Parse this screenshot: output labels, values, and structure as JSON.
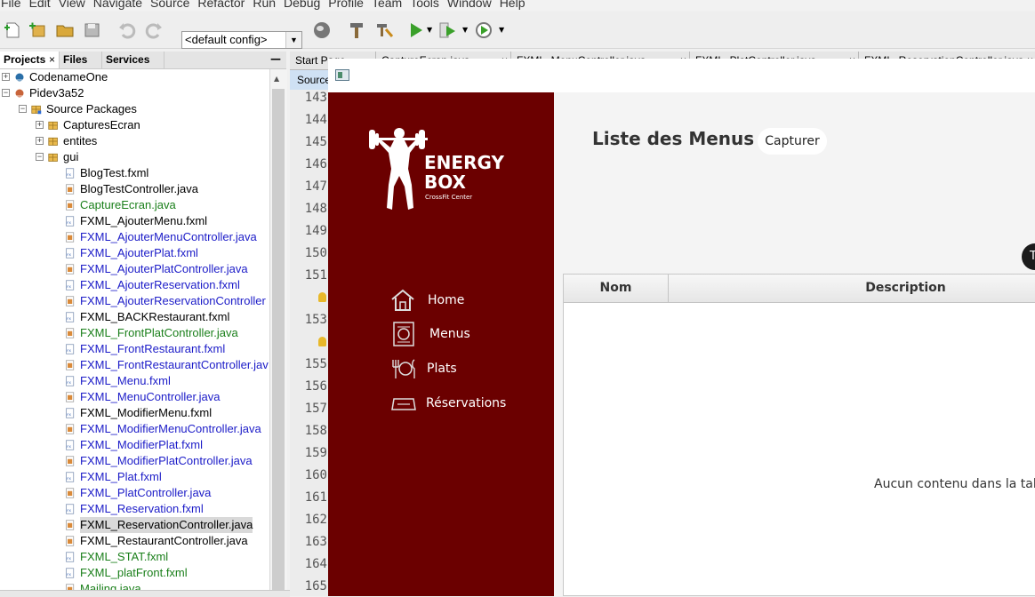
{
  "menubar": [
    "File",
    "Edit",
    "View",
    "Navigate",
    "Source",
    "Refactor",
    "Run",
    "Debug",
    "Profile",
    "Team",
    "Tools",
    "Window",
    "Help"
  ],
  "toolbar": {
    "config": "<default config>"
  },
  "project_panel": {
    "tabs": [
      "Projects",
      "Files",
      "Services"
    ],
    "close_glyph": "×",
    "minimize_glyph": "—"
  },
  "tree": [
    {
      "label": "CodenameOne",
      "level": 0,
      "kind": "project",
      "exp": "+",
      "color": "#000000"
    },
    {
      "label": "Pidev3a52",
      "level": 0,
      "kind": "project",
      "exp": "−",
      "color": "#000000"
    },
    {
      "label": "Source Packages",
      "level": 1,
      "kind": "srcpkg",
      "exp": "−",
      "color": "#000000"
    },
    {
      "label": "CapturesEcran",
      "level": 2,
      "kind": "package",
      "exp": "+",
      "color": "#000000"
    },
    {
      "label": "entites",
      "level": 2,
      "kind": "package",
      "exp": "+",
      "color": "#000000"
    },
    {
      "label": "gui",
      "level": 2,
      "kind": "package",
      "exp": "−",
      "color": "#000000"
    },
    {
      "label": "BlogTest.fxml",
      "level": 3,
      "kind": "fxml",
      "color": "#000000"
    },
    {
      "label": "BlogTestController.java",
      "level": 3,
      "kind": "java",
      "color": "#000000"
    },
    {
      "label": "CaptureEcran.java",
      "level": 3,
      "kind": "java",
      "color": "#1a7f1a"
    },
    {
      "label": "FXML_AjouterMenu.fxml",
      "level": 3,
      "kind": "fxml",
      "color": "#000000"
    },
    {
      "label": "FXML_AjouterMenuController.java",
      "level": 3,
      "kind": "java",
      "color": "#1c1cc8"
    },
    {
      "label": "FXML_AjouterPlat.fxml",
      "level": 3,
      "kind": "fxml",
      "color": "#1c1cc8"
    },
    {
      "label": "FXML_AjouterPlatController.java",
      "level": 3,
      "kind": "java",
      "color": "#1c1cc8"
    },
    {
      "label": "FXML_AjouterReservation.fxml",
      "level": 3,
      "kind": "fxml",
      "color": "#1c1cc8"
    },
    {
      "label": "FXML_AjouterReservationController",
      "level": 3,
      "kind": "java",
      "color": "#1c1cc8"
    },
    {
      "label": "FXML_BACKRestaurant.fxml",
      "level": 3,
      "kind": "fxml",
      "color": "#000000"
    },
    {
      "label": "FXML_FrontPlatController.java",
      "level": 3,
      "kind": "java",
      "color": "#1a7f1a"
    },
    {
      "label": "FXML_FrontRestaurant.fxml",
      "level": 3,
      "kind": "fxml",
      "color": "#1c1cc8"
    },
    {
      "label": "FXML_FrontRestaurantController.jav",
      "level": 3,
      "kind": "java",
      "color": "#1c1cc8"
    },
    {
      "label": "FXML_Menu.fxml",
      "level": 3,
      "kind": "fxml",
      "color": "#1c1cc8"
    },
    {
      "label": "FXML_MenuController.java",
      "level": 3,
      "kind": "java",
      "color": "#1c1cc8"
    },
    {
      "label": "FXML_ModifierMenu.fxml",
      "level": 3,
      "kind": "fxml",
      "color": "#000000"
    },
    {
      "label": "FXML_ModifierMenuController.java",
      "level": 3,
      "kind": "java",
      "color": "#1c1cc8"
    },
    {
      "label": "FXML_ModifierPlat.fxml",
      "level": 3,
      "kind": "fxml",
      "color": "#1c1cc8"
    },
    {
      "label": "FXML_ModifierPlatController.java",
      "level": 3,
      "kind": "java",
      "color": "#1c1cc8"
    },
    {
      "label": "FXML_Plat.fxml",
      "level": 3,
      "kind": "fxml",
      "color": "#1c1cc8"
    },
    {
      "label": "FXML_PlatController.java",
      "level": 3,
      "kind": "java",
      "color": "#1c1cc8"
    },
    {
      "label": "FXML_Reservation.fxml",
      "level": 3,
      "kind": "fxml",
      "color": "#1c1cc8"
    },
    {
      "label": "FXML_ReservationController.java",
      "level": 3,
      "kind": "java",
      "color": "#000000",
      "selected": true
    },
    {
      "label": "FXML_RestaurantController.java",
      "level": 3,
      "kind": "java",
      "color": "#000000"
    },
    {
      "label": "FXML_STAT.fxml",
      "level": 3,
      "kind": "fxml",
      "color": "#1a7f1a"
    },
    {
      "label": "FXML_platFront.fxml",
      "level": 3,
      "kind": "fxml",
      "color": "#1a7f1a"
    },
    {
      "label": "Mailing.java",
      "level": 3,
      "kind": "java",
      "color": "#1a7f1a"
    }
  ],
  "editor": {
    "tabs": [
      "Start Page",
      "CaptureEcran.java",
      "FXML_MenuController.java",
      "FXML_PlatController.java",
      "FXML_ReservationController.java"
    ],
    "tab_close": "×",
    "source_tab": "Source",
    "line_numbers": [
      "143",
      "144",
      "145",
      "146",
      "147",
      "148",
      "149",
      "150",
      "151",
      "",
      "153",
      "",
      "155",
      "156",
      "157",
      "158",
      "159",
      "160",
      "161",
      "162",
      "163",
      "164",
      "165"
    ]
  },
  "app": {
    "logo_line1": "ENERGY",
    "logo_line2": "BOX",
    "logo_tagline": "CrossFit Center",
    "nav": [
      {
        "label": "Home",
        "icon": "home-icon"
      },
      {
        "label": "Menus",
        "icon": "menu-card-icon"
      },
      {
        "label": "Plats",
        "icon": "plate-cutlery-icon"
      },
      {
        "label": "Réservations",
        "icon": "reservation-icon"
      }
    ],
    "title": "Liste des Menus",
    "capture_button": "Capturer",
    "round_button": "T",
    "table": {
      "columns": [
        "Nom",
        "Description"
      ],
      "empty_message": "Aucun contenu dans la table"
    },
    "colors": {
      "sidebar": "#6b0000",
      "content_bg": "#f4f4f4"
    }
  }
}
